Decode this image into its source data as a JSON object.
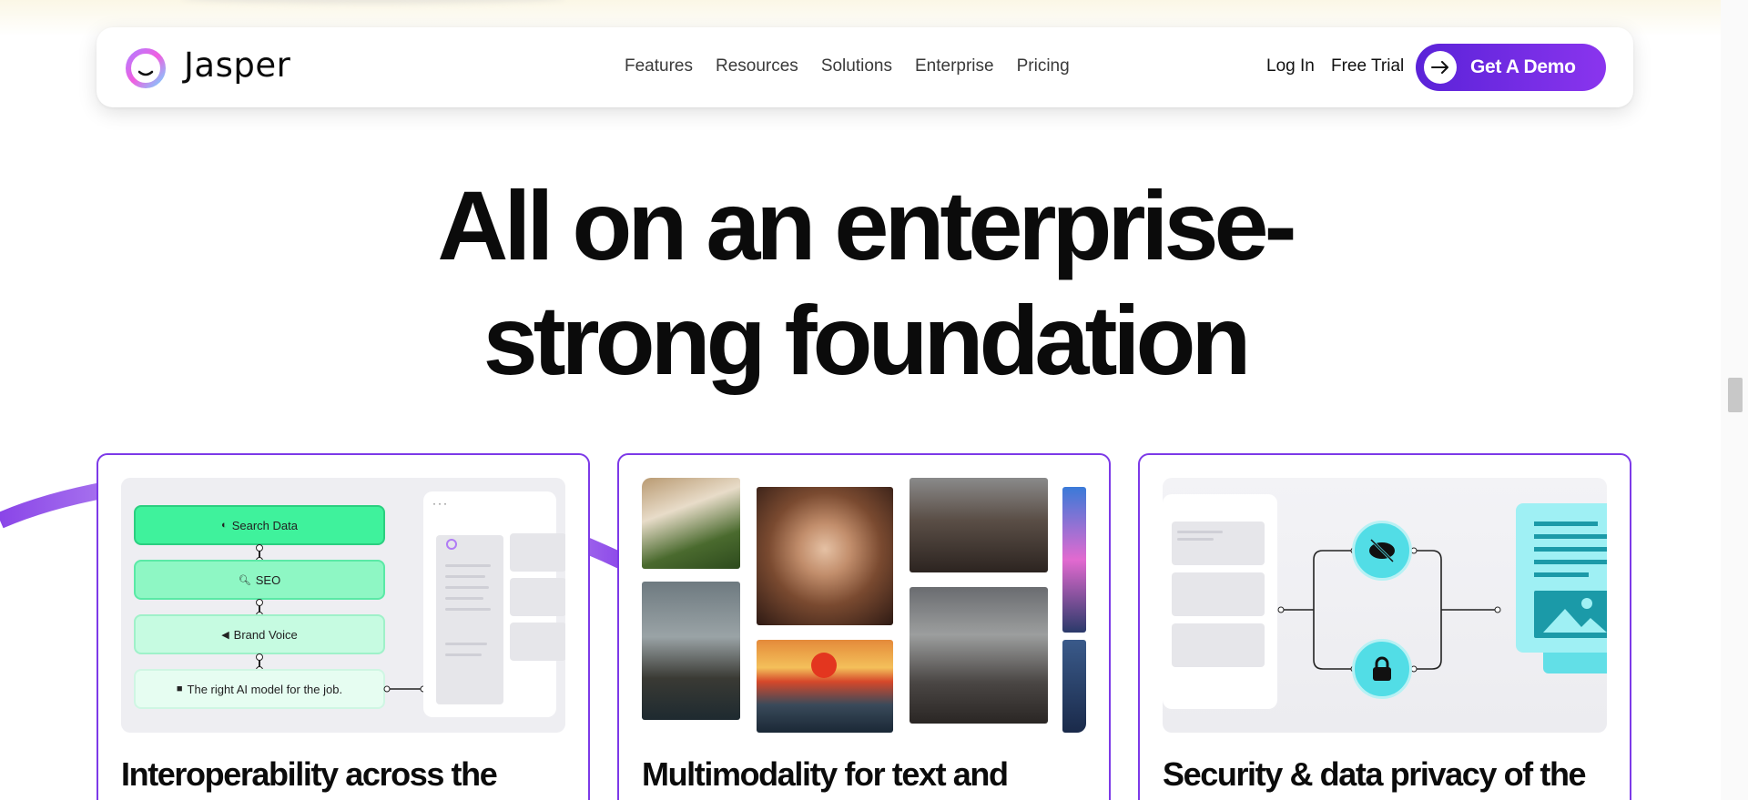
{
  "brand": {
    "name": "Jasper"
  },
  "nav": {
    "links": [
      "Features",
      "Resources",
      "Solutions",
      "Enterprise",
      "Pricing"
    ],
    "login": "Log In",
    "trial": "Free Trial",
    "demo": "Get A Demo"
  },
  "hero": {
    "line1": "All on an enterprise-",
    "line2": "strong foundation"
  },
  "cards": [
    {
      "title": "Interoperability across the",
      "flow": [
        "Search Data",
        "SEO",
        "Brand Voice",
        "The right AI model for the job."
      ]
    },
    {
      "title": "Multimodality for text and"
    },
    {
      "title": "Security & data privacy of the"
    }
  ],
  "colors": {
    "accent": "#7d3ae8",
    "flow_green": "#3ff29c",
    "node_cyan": "#52dde6"
  }
}
